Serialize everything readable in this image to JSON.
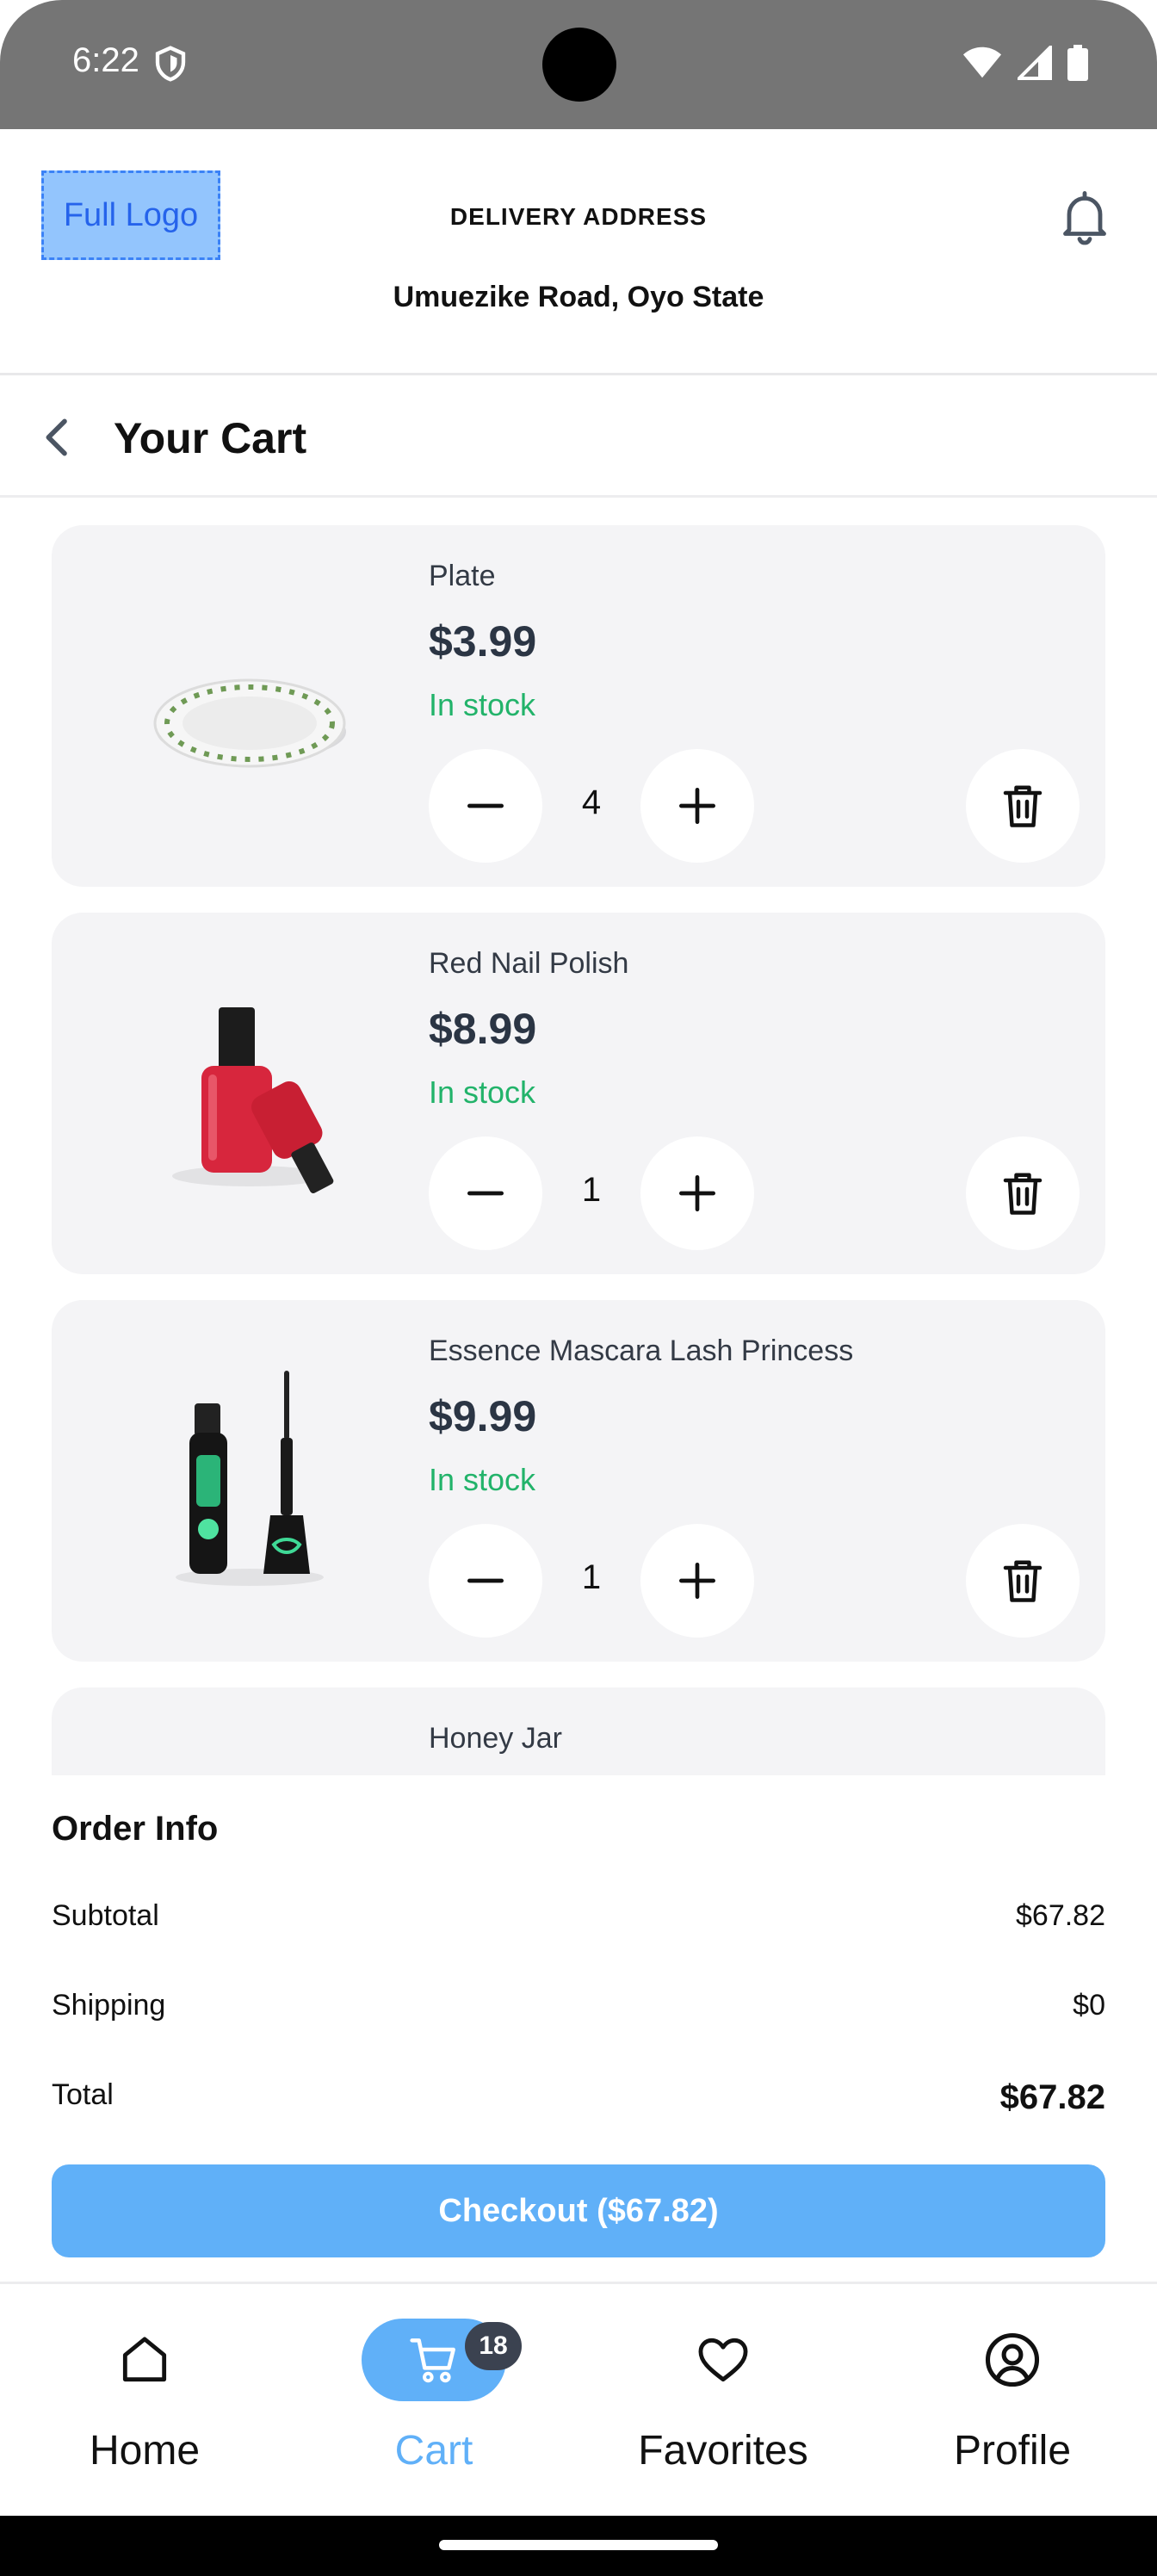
{
  "status_bar": {
    "time": "6:22"
  },
  "header": {
    "logo_text": "Full Logo",
    "delivery_label": "DELIVERY ADDRESS",
    "delivery_address": "Umuezike Road, Oyo State"
  },
  "page": {
    "title": "Your Cart"
  },
  "cart": {
    "items": [
      {
        "name": "Plate",
        "price": "$3.99",
        "stock": "In stock",
        "quantity": "4"
      },
      {
        "name": "Red Nail Polish",
        "price": "$8.99",
        "stock": "In stock",
        "quantity": "1"
      },
      {
        "name": "Essence Mascara Lash Princess",
        "price": "$9.99",
        "stock": "In stock",
        "quantity": "1"
      },
      {
        "name": "Honey Jar"
      }
    ]
  },
  "order_info": {
    "title": "Order Info",
    "subtotal_label": "Subtotal",
    "subtotal_value": "$67.82",
    "shipping_label": "Shipping",
    "shipping_value": "$0",
    "total_label": "Total",
    "total_value": "$67.82",
    "checkout_label": "Checkout ($67.82)"
  },
  "bottom_nav": {
    "items": [
      {
        "label": "Home",
        "icon": "home-icon"
      },
      {
        "label": "Cart",
        "icon": "cart-icon",
        "badge": "18",
        "active": true
      },
      {
        "label": "Favorites",
        "icon": "heart-icon"
      },
      {
        "label": "Profile",
        "icon": "profile-icon"
      }
    ]
  },
  "colors": {
    "accent": "#60b0f8",
    "in_stock": "#22b36a",
    "card_bg": "#f4f4f6",
    "badge_bg": "#3b4250"
  }
}
